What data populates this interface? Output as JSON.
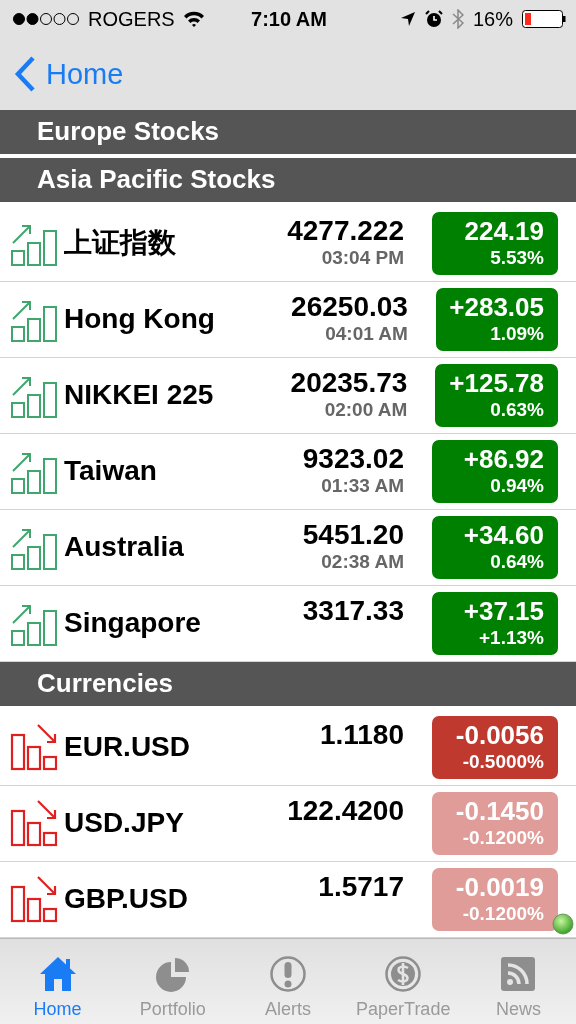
{
  "status_bar": {
    "carrier": "ROGERS",
    "time": "7:10 AM",
    "battery": "16%"
  },
  "nav": {
    "back": "Home"
  },
  "sections": [
    {
      "title": "Europe Stocks"
    },
    {
      "title": "Asia Pacific Stocks",
      "rows": [
        {
          "name": "上证指数",
          "kind": "up",
          "price": "4277.222",
          "time": "03:04 PM",
          "change": "224.19",
          "percent": "5.53%",
          "color": "#008000"
        },
        {
          "name": "Hong Kong",
          "kind": "up",
          "price": "26250.03",
          "time": "04:01 AM",
          "change": "+283.05",
          "percent": "1.09%",
          "color": "#008000"
        },
        {
          "name": "NIKKEI 225",
          "kind": "up",
          "price": "20235.73",
          "time": "02:00 AM",
          "change": "+125.78",
          "percent": "0.63%",
          "color": "#008000"
        },
        {
          "name": "Taiwan",
          "kind": "up",
          "price": "9323.02",
          "time": "01:33 AM",
          "change": "+86.92",
          "percent": "0.94%",
          "color": "#008000"
        },
        {
          "name": "Australia",
          "kind": "up",
          "price": "5451.20",
          "time": "02:38 AM",
          "change": "+34.60",
          "percent": "0.64%",
          "color": "#008000"
        },
        {
          "name": "Singapore",
          "kind": "up",
          "price": "3317.33",
          "change": "+37.15",
          "percent": "+1.13%",
          "color": "#008000"
        }
      ]
    },
    {
      "title": "Currencies",
      "rows": [
        {
          "name": "EUR.USD",
          "kind": "down",
          "price": "1.1180",
          "change": "-0.0056",
          "percent": "-0.5000%",
          "color": "#c0392f"
        },
        {
          "name": "USD.JPY",
          "kind": "down",
          "price": "122.4200",
          "change": "-0.1450",
          "percent": "-0.1200%",
          "color": "#e09c98"
        },
        {
          "name": "GBP.USD",
          "kind": "down",
          "price": "1.5717",
          "change": "-0.0019",
          "percent": "-0.1200%",
          "color": "#e09c98"
        }
      ]
    }
  ],
  "tabs": [
    {
      "label": "Home",
      "selected": true
    },
    {
      "label": "Portfolio",
      "selected": false
    },
    {
      "label": "Alerts",
      "selected": false
    },
    {
      "label": "PaperTrade",
      "selected": false
    },
    {
      "label": "News",
      "selected": false
    }
  ]
}
